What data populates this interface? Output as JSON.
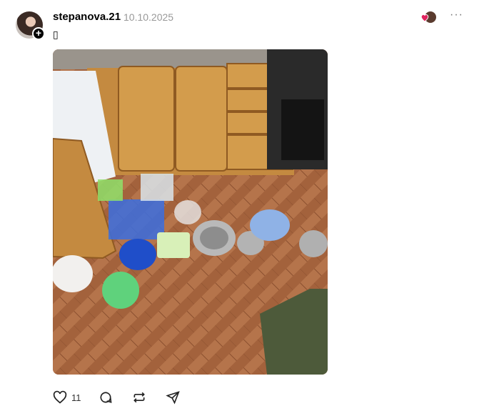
{
  "post": {
    "username": "stepanova.21",
    "date": "10.10.2025",
    "text": "▯"
  },
  "header": {
    "more_label": "···"
  },
  "actions": {
    "like_count": "11"
  },
  "colors": {
    "like_heart": "#e0245e",
    "icon_stroke": "#222222",
    "date_gray": "#999999"
  }
}
